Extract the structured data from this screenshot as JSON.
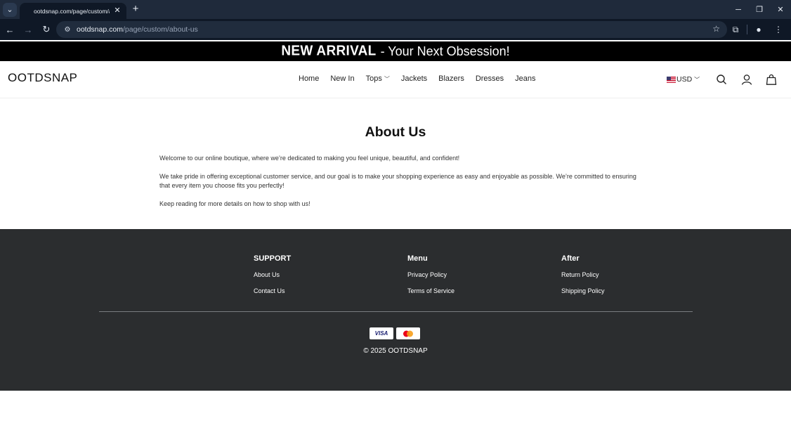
{
  "browser": {
    "tab_title": "ootdsnap.com/page/custom/about-us",
    "url_domain": "ootdsnap.com",
    "url_path": "/page/custom/about-us"
  },
  "announcement": {
    "bold": "NEW ARRIVAL",
    "rest": "- Your Next Obsession!"
  },
  "header": {
    "logo": "OOTDSNAP",
    "nav": [
      "Home",
      "New In",
      "Tops",
      "Jackets",
      "Blazers",
      "Dresses",
      "Jeans"
    ],
    "currency": "USD"
  },
  "main": {
    "title": "About Us",
    "paragraphs": [
      "Welcome to our online boutique, where we’re dedicated to making you feel unique, beautiful, and confident!",
      "We take pride in offering exceptional customer service, and our goal is to make your shopping experience as easy and enjoyable as possible. We’re committed to ensuring that every item you choose fits you perfectly!",
      "Keep reading for more details on how to shop with us!"
    ]
  },
  "footer": {
    "columns": [
      {
        "heading": "SUPPORT",
        "links": [
          "About Us",
          "Contact Us"
        ]
      },
      {
        "heading": "Menu",
        "links": [
          "Privacy Policy",
          "Terms of Service"
        ]
      },
      {
        "heading": "After",
        "links": [
          "Return Policy",
          "Shipping Policy"
        ]
      }
    ],
    "payments": [
      "VISA",
      "mastercard"
    ],
    "copyright": "© 2025 OOTDSNAP"
  },
  "icons": {
    "search": "search-icon",
    "account": "user-icon",
    "cart": "shopping-bag-icon",
    "dropdown": "chevron-down-icon"
  }
}
